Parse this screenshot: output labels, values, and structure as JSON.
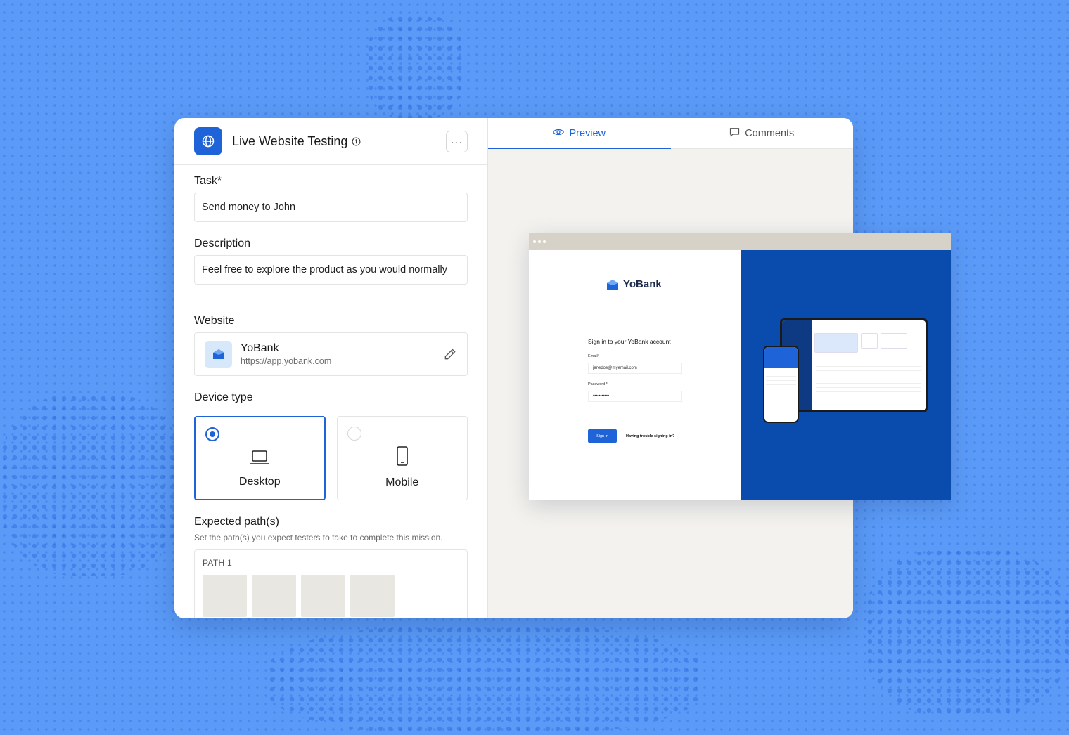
{
  "header": {
    "title": "Live Website Testing",
    "more_label": "···"
  },
  "form": {
    "task_label": "Task*",
    "task_value": "Send money to John",
    "description_label": "Description",
    "description_value": "Feel free to explore the product as you would normally",
    "website_label": "Website",
    "website": {
      "name": "YoBank",
      "url": "https://app.yobank.com"
    },
    "device_label": "Device type",
    "devices": [
      {
        "label": "Desktop",
        "selected": true
      },
      {
        "label": "Mobile",
        "selected": false
      }
    ],
    "paths_label": "Expected path(s)",
    "paths_hint": "Set the path(s) you expect testers to take to complete this mission.",
    "path_name": "PATH 1"
  },
  "tabs": [
    {
      "label": "Preview",
      "active": true,
      "icon": "eye-icon"
    },
    {
      "label": "Comments",
      "active": false,
      "icon": "comment-icon"
    }
  ],
  "preview": {
    "brand": "YoBank",
    "signin_title": "Sign in to your YoBank account",
    "email_label": "Email*",
    "email_value": "janedoe@myemail.com",
    "password_label": "Password *",
    "password_value": "•••••••••••",
    "signin_button": "Sign in",
    "trouble_link": "Having trouble signing in?"
  },
  "colors": {
    "accent": "#1f63d8",
    "background": "#5b9bf7",
    "brand_panel": "#0a4cad"
  }
}
